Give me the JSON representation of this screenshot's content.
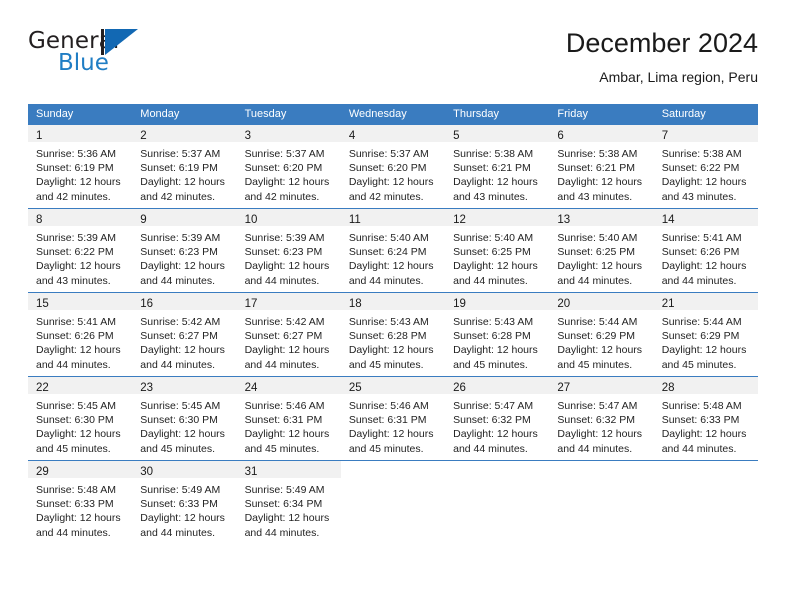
{
  "brand": {
    "name_part1": "General",
    "name_part2": "Blue",
    "mark": "triangle-flag-icon"
  },
  "header": {
    "title": "December 2024",
    "subtitle": "Ambar, Lima region, Peru"
  },
  "calendar": {
    "weekday_headers": [
      "Sunday",
      "Monday",
      "Tuesday",
      "Wednesday",
      "Thursday",
      "Friday",
      "Saturday"
    ],
    "accent_color": "#3a7cc0",
    "daynum_band_color": "#f1f1f1",
    "weeks": [
      [
        {
          "day": "1",
          "sunrise": "Sunrise: 5:36 AM",
          "sunset": "Sunset: 6:19 PM",
          "daylight1": "Daylight: 12 hours",
          "daylight2": "and 42 minutes."
        },
        {
          "day": "2",
          "sunrise": "Sunrise: 5:37 AM",
          "sunset": "Sunset: 6:19 PM",
          "daylight1": "Daylight: 12 hours",
          "daylight2": "and 42 minutes."
        },
        {
          "day": "3",
          "sunrise": "Sunrise: 5:37 AM",
          "sunset": "Sunset: 6:20 PM",
          "daylight1": "Daylight: 12 hours",
          "daylight2": "and 42 minutes."
        },
        {
          "day": "4",
          "sunrise": "Sunrise: 5:37 AM",
          "sunset": "Sunset: 6:20 PM",
          "daylight1": "Daylight: 12 hours",
          "daylight2": "and 42 minutes."
        },
        {
          "day": "5",
          "sunrise": "Sunrise: 5:38 AM",
          "sunset": "Sunset: 6:21 PM",
          "daylight1": "Daylight: 12 hours",
          "daylight2": "and 43 minutes."
        },
        {
          "day": "6",
          "sunrise": "Sunrise: 5:38 AM",
          "sunset": "Sunset: 6:21 PM",
          "daylight1": "Daylight: 12 hours",
          "daylight2": "and 43 minutes."
        },
        {
          "day": "7",
          "sunrise": "Sunrise: 5:38 AM",
          "sunset": "Sunset: 6:22 PM",
          "daylight1": "Daylight: 12 hours",
          "daylight2": "and 43 minutes."
        }
      ],
      [
        {
          "day": "8",
          "sunrise": "Sunrise: 5:39 AM",
          "sunset": "Sunset: 6:22 PM",
          "daylight1": "Daylight: 12 hours",
          "daylight2": "and 43 minutes."
        },
        {
          "day": "9",
          "sunrise": "Sunrise: 5:39 AM",
          "sunset": "Sunset: 6:23 PM",
          "daylight1": "Daylight: 12 hours",
          "daylight2": "and 44 minutes."
        },
        {
          "day": "10",
          "sunrise": "Sunrise: 5:39 AM",
          "sunset": "Sunset: 6:23 PM",
          "daylight1": "Daylight: 12 hours",
          "daylight2": "and 44 minutes."
        },
        {
          "day": "11",
          "sunrise": "Sunrise: 5:40 AM",
          "sunset": "Sunset: 6:24 PM",
          "daylight1": "Daylight: 12 hours",
          "daylight2": "and 44 minutes."
        },
        {
          "day": "12",
          "sunrise": "Sunrise: 5:40 AM",
          "sunset": "Sunset: 6:25 PM",
          "daylight1": "Daylight: 12 hours",
          "daylight2": "and 44 minutes."
        },
        {
          "day": "13",
          "sunrise": "Sunrise: 5:40 AM",
          "sunset": "Sunset: 6:25 PM",
          "daylight1": "Daylight: 12 hours",
          "daylight2": "and 44 minutes."
        },
        {
          "day": "14",
          "sunrise": "Sunrise: 5:41 AM",
          "sunset": "Sunset: 6:26 PM",
          "daylight1": "Daylight: 12 hours",
          "daylight2": "and 44 minutes."
        }
      ],
      [
        {
          "day": "15",
          "sunrise": "Sunrise: 5:41 AM",
          "sunset": "Sunset: 6:26 PM",
          "daylight1": "Daylight: 12 hours",
          "daylight2": "and 44 minutes."
        },
        {
          "day": "16",
          "sunrise": "Sunrise: 5:42 AM",
          "sunset": "Sunset: 6:27 PM",
          "daylight1": "Daylight: 12 hours",
          "daylight2": "and 44 minutes."
        },
        {
          "day": "17",
          "sunrise": "Sunrise: 5:42 AM",
          "sunset": "Sunset: 6:27 PM",
          "daylight1": "Daylight: 12 hours",
          "daylight2": "and 44 minutes."
        },
        {
          "day": "18",
          "sunrise": "Sunrise: 5:43 AM",
          "sunset": "Sunset: 6:28 PM",
          "daylight1": "Daylight: 12 hours",
          "daylight2": "and 45 minutes."
        },
        {
          "day": "19",
          "sunrise": "Sunrise: 5:43 AM",
          "sunset": "Sunset: 6:28 PM",
          "daylight1": "Daylight: 12 hours",
          "daylight2": "and 45 minutes."
        },
        {
          "day": "20",
          "sunrise": "Sunrise: 5:44 AM",
          "sunset": "Sunset: 6:29 PM",
          "daylight1": "Daylight: 12 hours",
          "daylight2": "and 45 minutes."
        },
        {
          "day": "21",
          "sunrise": "Sunrise: 5:44 AM",
          "sunset": "Sunset: 6:29 PM",
          "daylight1": "Daylight: 12 hours",
          "daylight2": "and 45 minutes."
        }
      ],
      [
        {
          "day": "22",
          "sunrise": "Sunrise: 5:45 AM",
          "sunset": "Sunset: 6:30 PM",
          "daylight1": "Daylight: 12 hours",
          "daylight2": "and 45 minutes."
        },
        {
          "day": "23",
          "sunrise": "Sunrise: 5:45 AM",
          "sunset": "Sunset: 6:30 PM",
          "daylight1": "Daylight: 12 hours",
          "daylight2": "and 45 minutes."
        },
        {
          "day": "24",
          "sunrise": "Sunrise: 5:46 AM",
          "sunset": "Sunset: 6:31 PM",
          "daylight1": "Daylight: 12 hours",
          "daylight2": "and 45 minutes."
        },
        {
          "day": "25",
          "sunrise": "Sunrise: 5:46 AM",
          "sunset": "Sunset: 6:31 PM",
          "daylight1": "Daylight: 12 hours",
          "daylight2": "and 45 minutes."
        },
        {
          "day": "26",
          "sunrise": "Sunrise: 5:47 AM",
          "sunset": "Sunset: 6:32 PM",
          "daylight1": "Daylight: 12 hours",
          "daylight2": "and 44 minutes."
        },
        {
          "day": "27",
          "sunrise": "Sunrise: 5:47 AM",
          "sunset": "Sunset: 6:32 PM",
          "daylight1": "Daylight: 12 hours",
          "daylight2": "and 44 minutes."
        },
        {
          "day": "28",
          "sunrise": "Sunrise: 5:48 AM",
          "sunset": "Sunset: 6:33 PM",
          "daylight1": "Daylight: 12 hours",
          "daylight2": "and 44 minutes."
        }
      ],
      [
        {
          "day": "29",
          "sunrise": "Sunrise: 5:48 AM",
          "sunset": "Sunset: 6:33 PM",
          "daylight1": "Daylight: 12 hours",
          "daylight2": "and 44 minutes."
        },
        {
          "day": "30",
          "sunrise": "Sunrise: 5:49 AM",
          "sunset": "Sunset: 6:33 PM",
          "daylight1": "Daylight: 12 hours",
          "daylight2": "and 44 minutes."
        },
        {
          "day": "31",
          "sunrise": "Sunrise: 5:49 AM",
          "sunset": "Sunset: 6:34 PM",
          "daylight1": "Daylight: 12 hours",
          "daylight2": "and 44 minutes."
        },
        {
          "day": "",
          "sunrise": "",
          "sunset": "",
          "daylight1": "",
          "daylight2": ""
        },
        {
          "day": "",
          "sunrise": "",
          "sunset": "",
          "daylight1": "",
          "daylight2": ""
        },
        {
          "day": "",
          "sunrise": "",
          "sunset": "",
          "daylight1": "",
          "daylight2": ""
        },
        {
          "day": "",
          "sunrise": "",
          "sunset": "",
          "daylight1": "",
          "daylight2": ""
        }
      ]
    ]
  }
}
